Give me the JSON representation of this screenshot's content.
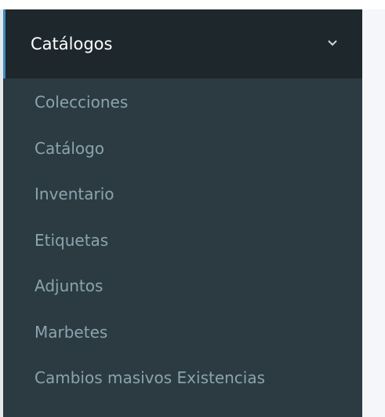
{
  "sidebar": {
    "section_title": "Catálogos",
    "items": [
      {
        "label": "Colecciones"
      },
      {
        "label": "Catálogo"
      },
      {
        "label": "Inventario"
      },
      {
        "label": "Etiquetas"
      },
      {
        "label": "Adjuntos"
      },
      {
        "label": "Marbetes"
      },
      {
        "label": "Cambios masivos Existencias"
      }
    ]
  },
  "icons": {
    "expand": "chevron-down-icon"
  },
  "colors": {
    "sidebar_bg": "#2c3b41",
    "header_bg": "#1e282c",
    "accent": "#3c8dbc",
    "item_text": "#8aa4af",
    "header_text": "#ffffff",
    "content_bg": "#f4f6f9"
  }
}
